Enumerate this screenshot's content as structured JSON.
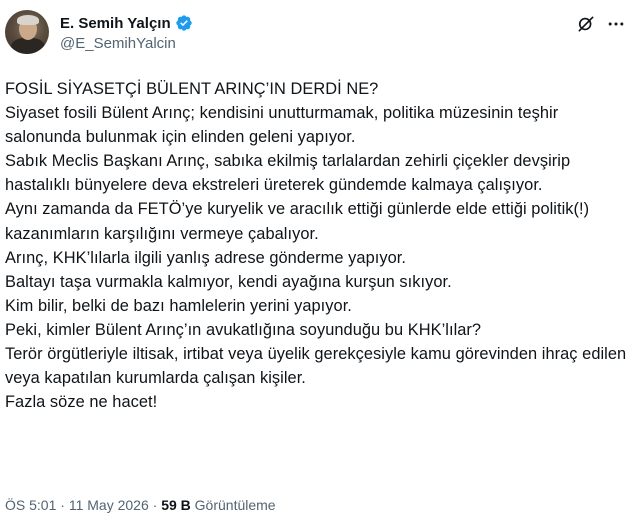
{
  "author": {
    "display_name": "E. Semih Yalçın",
    "handle": "@E_SemihYalcin",
    "verified_color": "#1d9bf0"
  },
  "icons": {
    "grok": "grok-icon",
    "more": "more-icon",
    "verified": "verified-badge-icon"
  },
  "tweet": {
    "lines": [
      "FOSİL SİYASETÇİ BÜLENT ARINÇ’IN DERDİ NE?",
      "Siyaset fosili Bülent Arınç; kendisini unutturmamak, politika müzesinin teşhir salonunda bulunmak için elinden geleni yapıyor.",
      "Sabık Meclis Başkanı Arınç, sabıka ekilmiş tarlalardan zehirli çiçekler devşirip hastalıklı bünyelere deva ekstreleri üreterek gündemde kalmaya çalışıyor.",
      "Aynı zamanda da FETÖ’ye kuryelik ve aracılık ettiği günlerde elde ettiği politik(!) kazanımların karşılığını vermeye çabalıyor.",
      "Arınç, KHK’lılarla ilgili yanlış adrese gönderme yapıyor.",
      "Baltayı taşa vurmakla kalmıyor, kendi ayağına kurşun sıkıyor.",
      "Kim bilir, belki de bazı hamlelerin yerini yapıyor.",
      "Peki, kimler Bülent Arınç’ın avukatlığına soyunduğu bu KHK’lılar?",
      "Terör örgütleriyle iltisak, irtibat veya üyelik gerekçesiyle kamu görevinden ihraç edilen veya kapatılan kurumlarda çalışan kişiler.",
      "Fazla söze ne hacet!"
    ]
  },
  "meta": {
    "time": "ÖS 5:01",
    "separator": "·",
    "date": "11 May 2026",
    "views_count": "59 B",
    "views_label": "Görüntüleme"
  }
}
